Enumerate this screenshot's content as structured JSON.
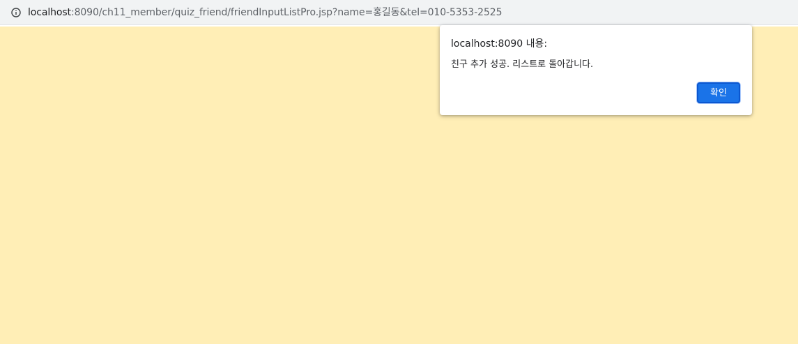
{
  "address_bar": {
    "url_host": "localhost",
    "url_rest": ":8090/ch11_member/quiz_friend/friendInputListPro.jsp?name=홍길동&tel=010-5353-2525",
    "info_icon": "info-circle-icon"
  },
  "page": {
    "background_color": "#ffeeb6"
  },
  "alert": {
    "title": "localhost:8090 내용:",
    "message": "친구 추가 성공. 리스트로 돌아갑니다.",
    "confirm_label": "확인",
    "button_color": "#1a73e8"
  }
}
